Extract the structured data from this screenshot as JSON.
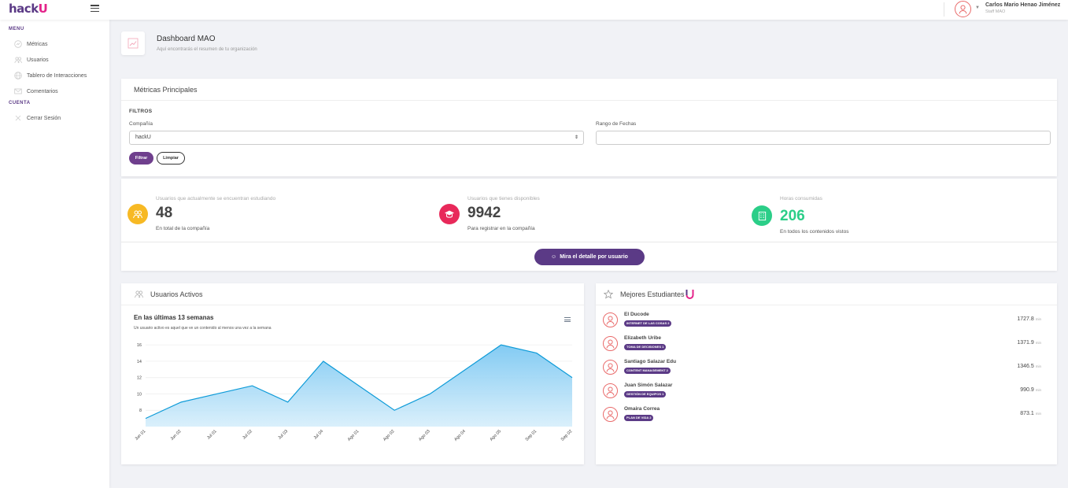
{
  "brand": {
    "part1": "hack",
    "part2": "U"
  },
  "header": {
    "user_name": "Carlos Mario Henao Jiménez",
    "user_role": "Staff MAO"
  },
  "sidebar": {
    "menu_heading": "MENU",
    "items": [
      {
        "label": "Métricas",
        "icon": "chart-icon"
      },
      {
        "label": "Usuarios",
        "icon": "users-icon"
      },
      {
        "label": "Tablero de Interacciones",
        "icon": "globe-icon"
      },
      {
        "label": "Comentarios",
        "icon": "mail-icon"
      }
    ],
    "account_heading": "CUENTA",
    "logout": {
      "label": "Cerrar Sesión",
      "icon": "close-icon"
    }
  },
  "page": {
    "title": "Dashboard MAO",
    "subtitle": "Aquí encontrarás el resumen de tu organización"
  },
  "metrics": {
    "title": "Métricas Principales",
    "filters_label": "FILTROS",
    "company_label": "Compañía",
    "company_value": "hackU",
    "date_label": "Rango de Fechas",
    "date_value": "",
    "filter_button": "Filtrar",
    "clear_button": "Limpiar"
  },
  "stats": [
    {
      "label": "Usuarios que actualmente se encuentran estudiando",
      "value": "48",
      "footer": "En total de la compañía",
      "icon": "users-icon",
      "color": "#f7b924"
    },
    {
      "label": "Usuarios que tienes disponibles",
      "value": "9942",
      "footer": "Para registrar en la compañía",
      "icon": "graduation-cap-icon",
      "color": "#e8295a"
    },
    {
      "label": "Horas consumidas",
      "value": "206",
      "footer": "En todos los contenidos vistos",
      "icon": "building-icon",
      "color": "#2bce88"
    }
  ],
  "detail_button": "Mira el detalle por usuario",
  "active_users": {
    "header": "Usuarios Activos"
  },
  "chart_data": {
    "type": "area",
    "title": "En las últimas 13 semanas",
    "subtitle": "Un usuario activo es aquel que ve un contenido al menos una vez a la semana",
    "categories": [
      "Jun 01",
      "Jun 02",
      "Jul 01",
      "Jul 02",
      "Jul 03",
      "Jul 04",
      "Ago 01",
      "Ago 02",
      "Ago 03",
      "Ago 04",
      "Ago 05",
      "Sep 01",
      "Sep 02"
    ],
    "values": [
      7,
      9,
      10,
      11,
      9,
      14,
      11,
      8,
      10,
      13,
      16,
      15,
      12
    ],
    "yticks": [
      8,
      10,
      12,
      14,
      16
    ],
    "ylim": [
      6,
      16.5
    ],
    "line_color": "#0e9bd8",
    "grid": true
  },
  "best_students": {
    "header": "Mejores Estudiantes",
    "unit": "min",
    "items": [
      {
        "name": "El Ducode",
        "badge": "INTERNET DE LAS COSAS 2",
        "value": "1727.8"
      },
      {
        "name": "Elizabeth Uribe",
        "badge": "TOMA DE DECISIONES 1",
        "value": "1371.9"
      },
      {
        "name": "Santiago Salazar Edu",
        "badge": "CONTENT MANAGEMENT 2",
        "value": "1346.5"
      },
      {
        "name": "Juan Simón Salazar",
        "badge": "GESTIÓN DE EQUIPOS 1",
        "value": "990.9"
      },
      {
        "name": "Omaira Correa",
        "badge": "PLAN DE VIDA 2",
        "value": "873.1"
      }
    ]
  }
}
